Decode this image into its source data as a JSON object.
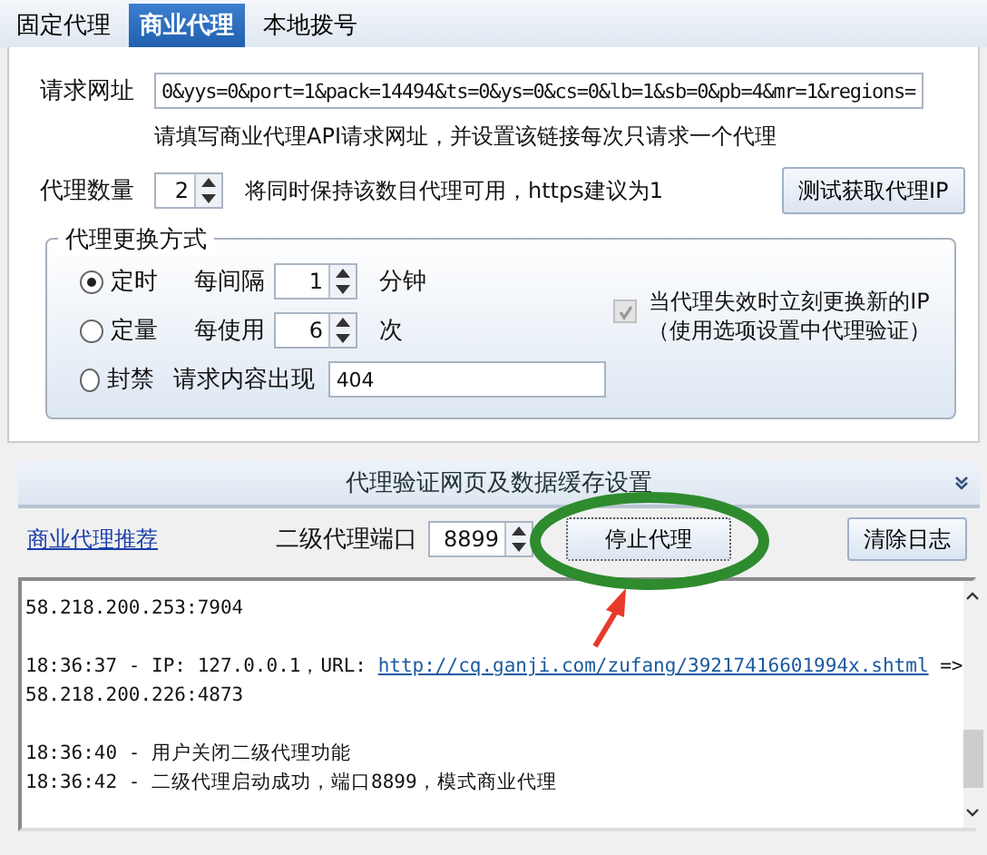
{
  "tabs": [
    {
      "label": "固定代理",
      "selected": false
    },
    {
      "label": "商业代理",
      "selected": true
    },
    {
      "label": "本地拨号",
      "selected": false
    }
  ],
  "request_url": {
    "label": "请求网址",
    "value": "0&yys=0&port=1&pack=14494&ts=0&ys=0&cs=0&lb=1&sb=0&pb=4&mr=1&regions=",
    "hint": "请填写商业代理API请求网址，并设置该链接每次只请求一个代理"
  },
  "proxy_count": {
    "label": "代理数量",
    "value": "2",
    "note": "将同时保持该数目代理可用，https建议为1",
    "button": "测试获取代理IP"
  },
  "rotation": {
    "title": "代理更换方式",
    "options": [
      {
        "label": "定时",
        "selected": true,
        "kind": "spinner",
        "prefix": "每间隔",
        "value": "1",
        "suffix": "分钟"
      },
      {
        "label": "定量",
        "selected": false,
        "kind": "spinner",
        "prefix": "每使用",
        "value": "6",
        "suffix": "次"
      },
      {
        "label": "封禁",
        "selected": false,
        "kind": "text",
        "prefix": "请求内容出现",
        "value": "404"
      }
    ],
    "auto_replace": {
      "label": "当代理失效时立刻更换新的IP",
      "note": "（使用选项设置中代理验证）",
      "checked": true,
      "disabled": true
    }
  },
  "collapsed_section": {
    "title": "代理验证网页及数据缓存设置",
    "expanded": false
  },
  "controls": {
    "link": "商业代理推荐",
    "port_label": "二级代理端口",
    "port_value": "8899",
    "stop_button": "停止代理",
    "clear_button": "清除日志"
  },
  "log": [
    {
      "text": "58.218.200.253:7904",
      "blank_line_before": false
    },
    {
      "text": "18:36:37 - IP: 127.0.0.1，URL: ",
      "blank_line_before": true,
      "link": "http://cq.ganji.com/zufang/39217416601994x.shtml",
      "after": " =>"
    },
    {
      "text": "58.218.200.226:4873",
      "blank_line_before": false
    },
    {
      "text": "18:36:40 - 用户关闭二级代理功能",
      "blank_line_before": true
    },
    {
      "text": "18:36:42 - 二级代理启动成功，端口8899，模式商业代理",
      "blank_line_before": false
    }
  ]
}
